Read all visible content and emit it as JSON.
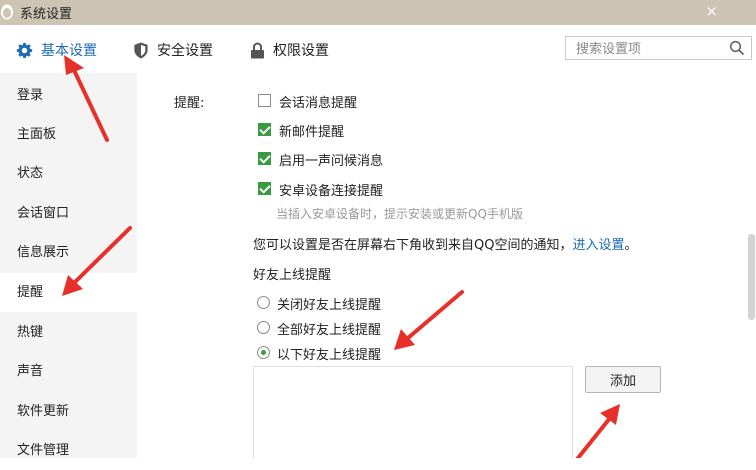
{
  "window": {
    "title": "系统设置",
    "close_glyph": "×"
  },
  "tabs": [
    {
      "label": "基本设置",
      "icon": "gear-icon",
      "active": true
    },
    {
      "label": "安全设置",
      "icon": "shield-icon",
      "active": false
    },
    {
      "label": "权限设置",
      "icon": "lock-icon",
      "active": false
    }
  ],
  "search": {
    "placeholder": "搜索设置项",
    "value": ""
  },
  "sidebar": {
    "items": [
      {
        "label": "登录"
      },
      {
        "label": "主面板"
      },
      {
        "label": "状态"
      },
      {
        "label": "会话窗口"
      },
      {
        "label": "信息展示"
      },
      {
        "label": "提醒",
        "active": true
      },
      {
        "label": "热键"
      },
      {
        "label": "声音"
      },
      {
        "label": "软件更新"
      },
      {
        "label": "文件管理"
      }
    ]
  },
  "reminder": {
    "section_label": "提醒:",
    "options": [
      {
        "label": "会话消息提醒",
        "checked": false
      },
      {
        "label": "新邮件提醒",
        "checked": true
      },
      {
        "label": "启用一声问候消息",
        "checked": true
      },
      {
        "label": "安卓设备连接提醒",
        "checked": true
      }
    ],
    "android_hint": "当插入安卓设备时，提示安装或更新QQ手机版",
    "qzone_notice": "您可以设置是否在屏幕右下角收到来自QQ空间的通知，",
    "qzone_link": "进入设置",
    "qzone_end": "。",
    "friend_online": {
      "title": "好友上线提醒",
      "options": [
        {
          "label": "关闭好友上线提醒",
          "checked": false
        },
        {
          "label": "全部好友上线提醒",
          "checked": false
        },
        {
          "label": "以下好友上线提醒",
          "checked": true
        }
      ],
      "add_button": "添加"
    }
  },
  "colors": {
    "accent": "#1b6bb5",
    "check": "#3a9a3f",
    "arrow": "#e8302a",
    "titlebar": "#cdc4b4"
  }
}
